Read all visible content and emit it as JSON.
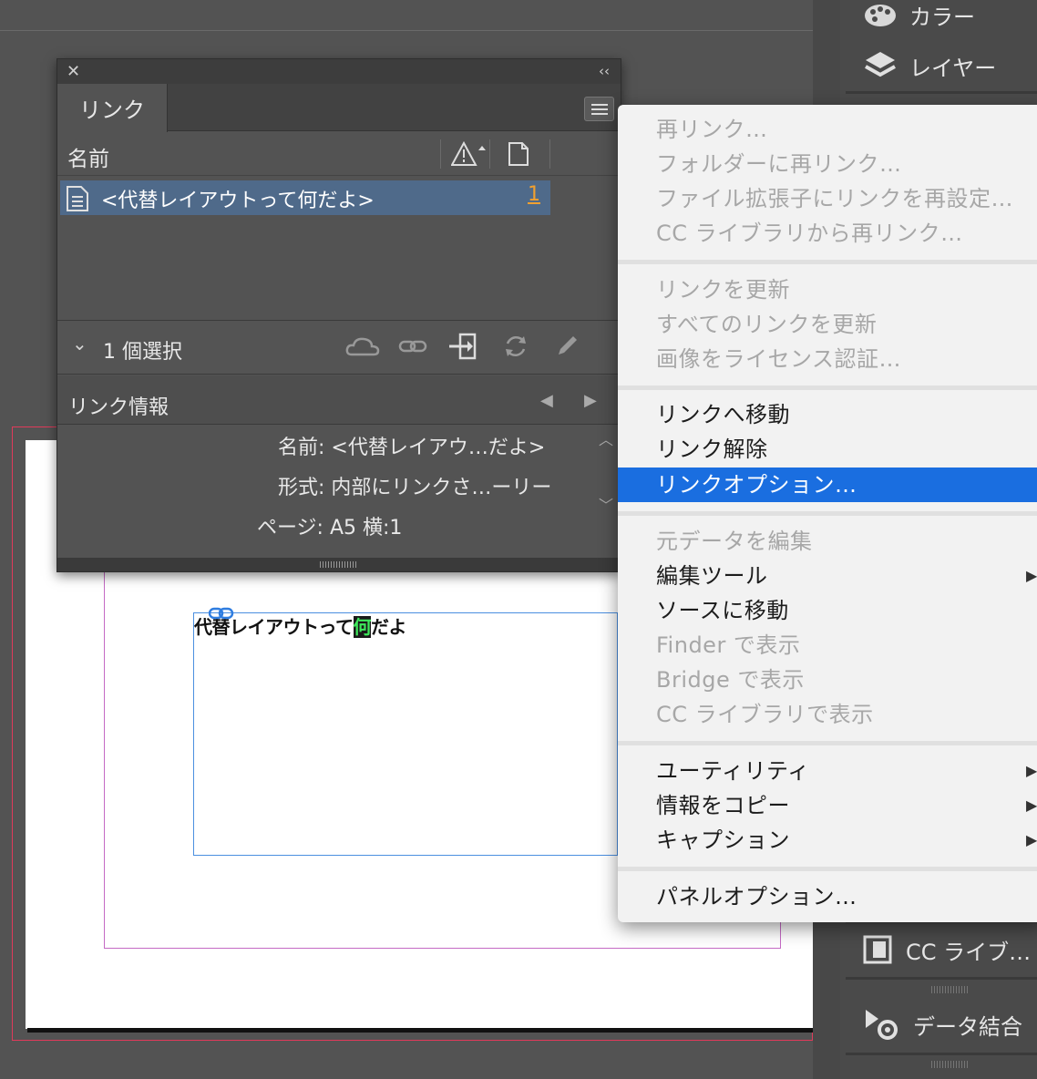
{
  "document": {
    "text": "代替レイアウトって",
    "highlighted_char": "何",
    "text_after": "だよ"
  },
  "dock": {
    "items": [
      {
        "label": "カラー",
        "icon": "palette-icon"
      },
      {
        "label": "レイヤー",
        "icon": "layers-icon"
      },
      {
        "label": "CC ライブ…",
        "icon": "cc-library-icon"
      },
      {
        "label": "データ結合",
        "icon": "data-merge-icon"
      }
    ]
  },
  "links_panel": {
    "tab_label": "リンク",
    "column_name": "名前",
    "rows": [
      {
        "name": "<代替レイアウトって何だよ>",
        "page": "1",
        "selected": true
      }
    ],
    "selection_count": "1 個選択",
    "info_title": "リンク情報",
    "info": [
      {
        "label": "名前:",
        "value": "<代替レイアウ…だよ>"
      },
      {
        "label": "形式:",
        "value": "内部にリンクさ…ーリー"
      },
      {
        "label": "ページ:",
        "value": "A5 横:1"
      }
    ]
  },
  "context_menu": {
    "groups": [
      [
        {
          "label": "再リンク…",
          "enabled": false
        },
        {
          "label": "フォルダーに再リンク…",
          "enabled": false
        },
        {
          "label": "ファイル拡張子にリンクを再設定…",
          "enabled": false
        },
        {
          "label": "CC ライブラリから再リンク…",
          "enabled": false
        }
      ],
      [
        {
          "label": "リンクを更新",
          "enabled": false
        },
        {
          "label": "すべてのリンクを更新",
          "enabled": false
        },
        {
          "label": "画像をライセンス認証…",
          "enabled": false
        }
      ],
      [
        {
          "label": "リンクへ移動",
          "enabled": true
        },
        {
          "label": "リンク解除",
          "enabled": true
        },
        {
          "label": "リンクオプション…",
          "enabled": true,
          "highlighted": true
        }
      ],
      [
        {
          "label": "元データを編集",
          "enabled": false
        },
        {
          "label": "編集ツール",
          "enabled": true,
          "submenu": true
        },
        {
          "label": "ソースに移動",
          "enabled": true
        },
        {
          "label": "Finder で表示",
          "enabled": false
        },
        {
          "label": "Bridge で表示",
          "enabled": false
        },
        {
          "label": "CC ライブラリで表示",
          "enabled": false
        }
      ],
      [
        {
          "label": "ユーティリティ",
          "enabled": true,
          "submenu": true
        },
        {
          "label": "情報をコピー",
          "enabled": true,
          "submenu": true
        },
        {
          "label": "キャプション",
          "enabled": true,
          "submenu": true
        }
      ],
      [
        {
          "label": "パネルオプション…",
          "enabled": true
        }
      ]
    ]
  },
  "colors": {
    "menu_highlight": "#1a6ee0",
    "selected_row": "#4f6a8a",
    "page_number": "#f0a030",
    "text_highlight": "#3ee85c"
  }
}
